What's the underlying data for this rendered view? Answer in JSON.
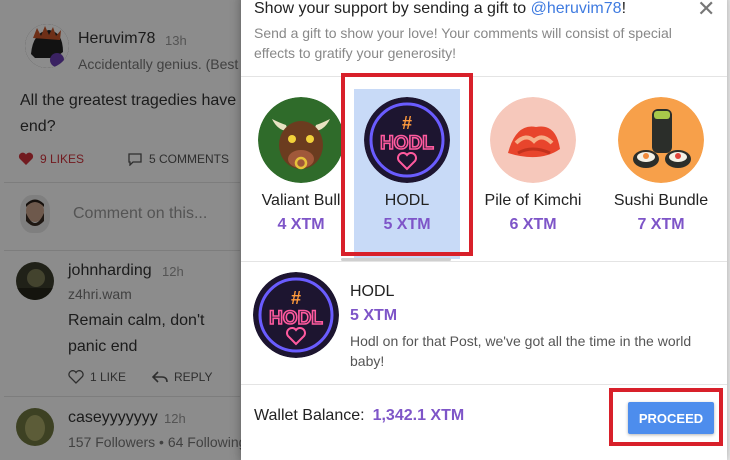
{
  "feed": {
    "post": {
      "username": "Heruvim78",
      "time": "13h",
      "tagline": "Accidentally genius. (Best",
      "text": "All the greatest tragedies have end?",
      "likes": "9 LIKES",
      "comments": "5 COMMENTS"
    },
    "comment_placeholder": "Comment on this...",
    "comments": [
      {
        "username": "johnharding",
        "time": "12h",
        "subline": "z4hri.wam",
        "text": "Remain calm, don't panic end",
        "likes": "1 LIKE",
        "reply": "REPLY"
      },
      {
        "username": "caseyyyyyyy",
        "time": "12h",
        "subline": "157 Followers • 64 Following"
      }
    ]
  },
  "modal": {
    "title_prefix": "Show your support by sending a gift to ",
    "title_handle": "@heruvim78",
    "title_suffix": "!",
    "subtitle": "Send a gift to show your love! Your comments will consist of special effects to gratify your generosity!",
    "close_icon": "✕",
    "gifts": [
      {
        "name": "Valiant Bull",
        "price": "4 XTM",
        "icon": "bull-icon",
        "selected": false
      },
      {
        "name": "HODL",
        "price": "5 XTM",
        "icon": "hodl-neon-icon",
        "selected": true
      },
      {
        "name": "Pile of Kimchi",
        "price": "6 XTM",
        "icon": "kimchi-icon",
        "selected": false
      },
      {
        "name": "Sushi Bundle",
        "price": "7 XTM",
        "icon": "sushi-icon",
        "selected": false
      }
    ],
    "detail": {
      "name": "HODL",
      "price": "5 XTM",
      "description": "Hodl on for that Post, we've got all the time in the world baby!"
    },
    "wallet_label": "Wallet Balance:",
    "wallet_balance": "1,342.1 XTM",
    "proceed_label": "PROCEED"
  },
  "colors": {
    "accent_purple": "#7e55c8",
    "link_blue": "#3f7be0",
    "button_blue": "#4d8ded",
    "selected_bg": "#c8daf7",
    "highlight_red": "#d8202a",
    "like_red": "#d0323b"
  }
}
